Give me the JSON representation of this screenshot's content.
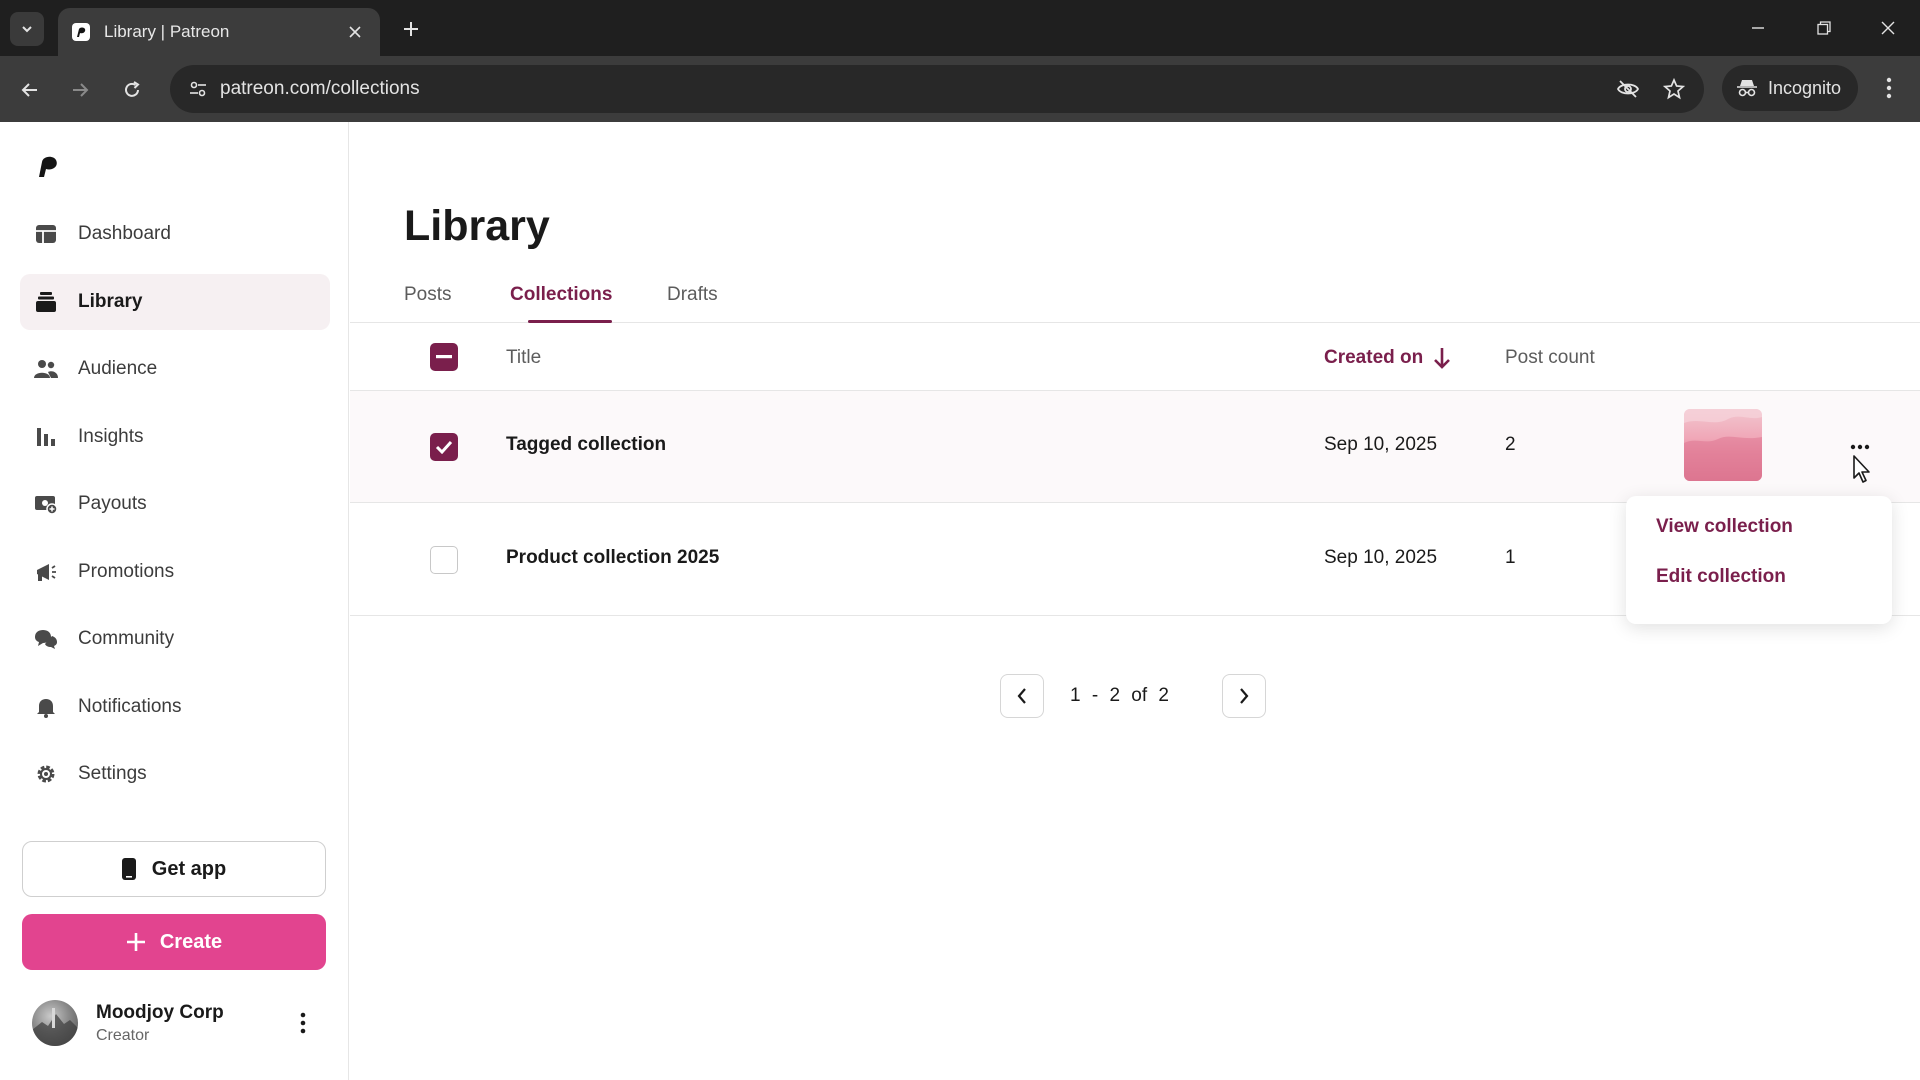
{
  "browser": {
    "tab_title": "Library | Patreon",
    "url": "patreon.com/collections",
    "incognito_label": "Incognito"
  },
  "sidebar": {
    "items": [
      {
        "label": "Dashboard",
        "icon": "dashboard-icon"
      },
      {
        "label": "Library",
        "icon": "library-icon",
        "active": true
      },
      {
        "label": "Audience",
        "icon": "audience-icon"
      },
      {
        "label": "Insights",
        "icon": "insights-icon"
      },
      {
        "label": "Payouts",
        "icon": "payouts-icon"
      },
      {
        "label": "Promotions",
        "icon": "promotions-icon"
      },
      {
        "label": "Community",
        "icon": "community-icon"
      },
      {
        "label": "Notifications",
        "icon": "notifications-icon"
      },
      {
        "label": "Settings",
        "icon": "settings-icon"
      }
    ],
    "get_app_label": "Get app",
    "create_label": "Create",
    "profile": {
      "name": "Moodjoy Corp",
      "role": "Creator"
    }
  },
  "main": {
    "title": "Library",
    "tabs": [
      {
        "label": "Posts"
      },
      {
        "label": "Collections",
        "active": true
      },
      {
        "label": "Drafts"
      }
    ],
    "columns": {
      "title": "Title",
      "created_on": "Created on",
      "post_count": "Post count"
    },
    "rows": [
      {
        "title": "Tagged collection",
        "created_on": "Sep 10, 2025",
        "post_count": "2",
        "selected": true
      },
      {
        "title": "Product collection 2025",
        "created_on": "Sep 10, 2025",
        "post_count": "1",
        "selected": false
      }
    ],
    "row_menu": {
      "view": "View collection",
      "edit": "Edit collection"
    },
    "pagination": {
      "text": "1 - 2 of 2"
    }
  },
  "colors": {
    "accent": "#7a1f4c",
    "create": "#e2448f"
  }
}
